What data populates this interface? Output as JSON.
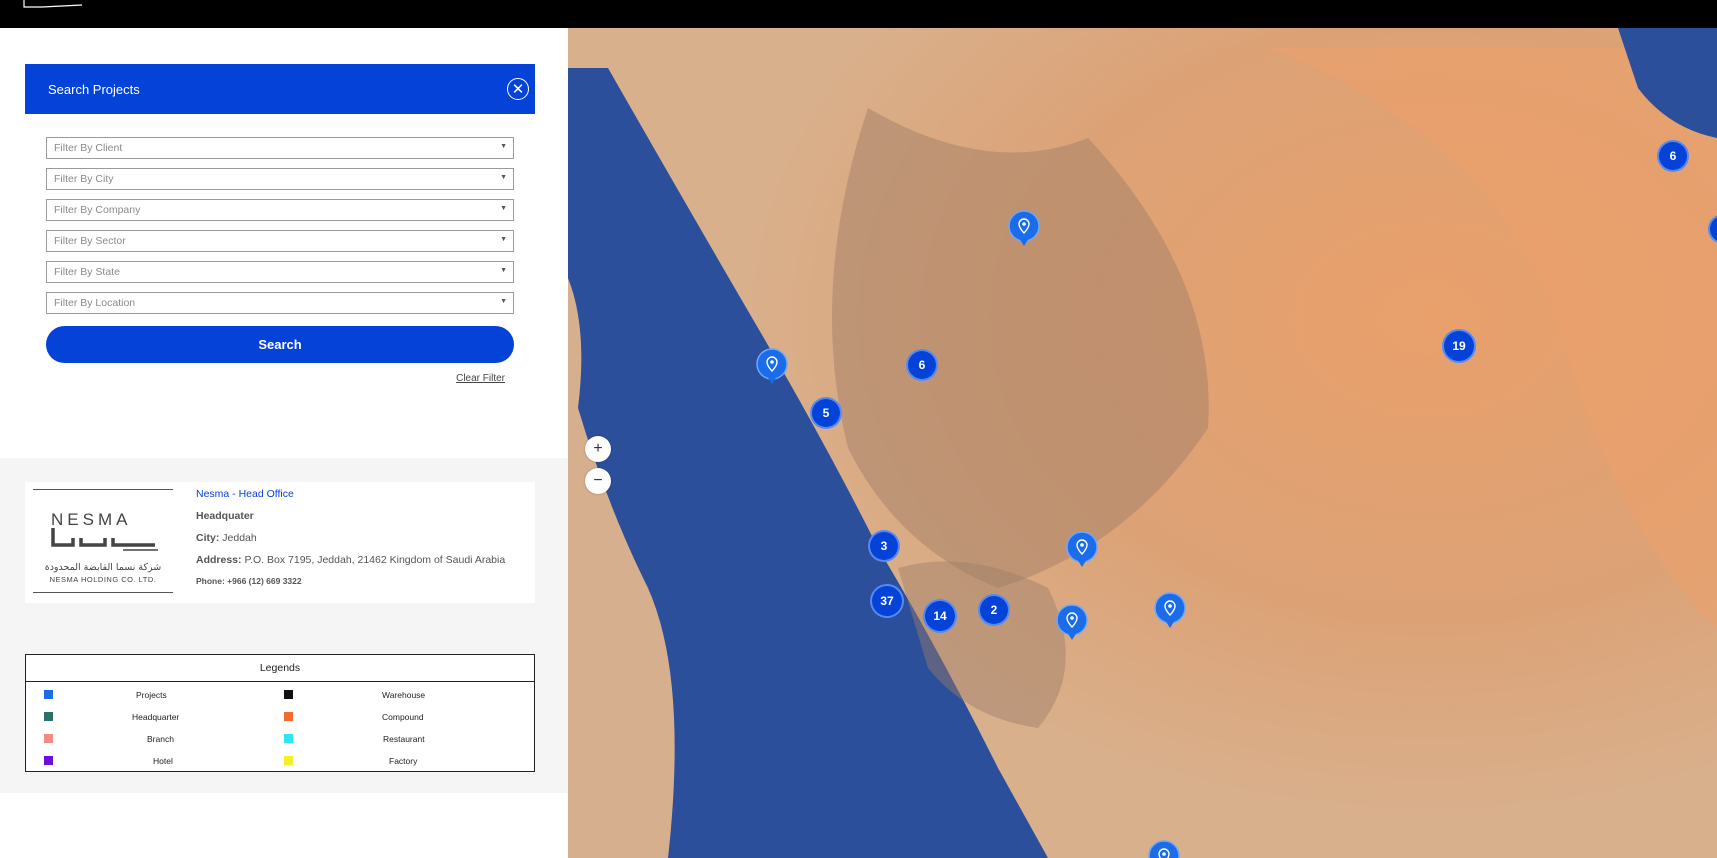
{
  "search": {
    "title": "Search Projects",
    "filters": [
      {
        "placeholder": "Filter By Client"
      },
      {
        "placeholder": "Filter By City"
      },
      {
        "placeholder": "Filter By Company"
      },
      {
        "placeholder": "Filter By Sector"
      },
      {
        "placeholder": "Filter By State"
      },
      {
        "placeholder": "Filter By Location"
      }
    ],
    "search_label": "Search",
    "clear_label": "Clear Filter"
  },
  "office": {
    "logo_text": "NESMA",
    "logo_arabic": "شركة نسما القابضة المحدودة",
    "logo_english": "NESMA HOLDING CO. LTD.",
    "name": "Nesma - Head Office",
    "type": "Headquater",
    "city_label": "City:",
    "city": "Jeddah",
    "address_label": "Address:",
    "address": "P.O. Box 7195, Jeddah, 21462 Kingdom of Saudi Arabia",
    "phone": "Phone: +966 (12) 669 3322"
  },
  "legends": {
    "title": "Legends",
    "items": [
      {
        "label": "Projects",
        "color": "#1a6ce8"
      },
      {
        "label": "Warehouse",
        "color": "#111111"
      },
      {
        "label": "Headquarter",
        "color": "#2e6f6a"
      },
      {
        "label": "Compound",
        "color": "#f26a2e"
      },
      {
        "label": "Branch",
        "color": "#f08b86"
      },
      {
        "label": "Restaurant",
        "color": "#2ee6f0"
      },
      {
        "label": "Hotel",
        "color": "#6a0fe0"
      },
      {
        "label": "Factory",
        "color": "#f5ef2a"
      }
    ]
  },
  "map": {
    "zoom_in": "+",
    "zoom_out": "−",
    "clusters": [
      "6",
      "19",
      "6",
      "5",
      "3",
      "37",
      "14",
      "2"
    ],
    "colors": {
      "sea": "#2c4f9c",
      "land": "#e2a877",
      "marker": "#0442d8"
    }
  }
}
